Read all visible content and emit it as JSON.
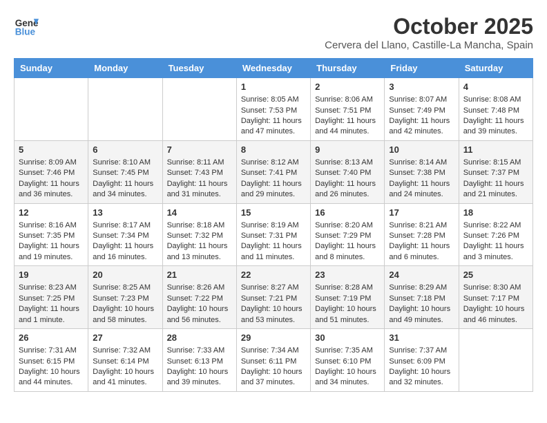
{
  "header": {
    "logo_line1": "General",
    "logo_line2": "Blue",
    "month_title": "October 2025",
    "subtitle": "Cervera del Llano, Castille-La Mancha, Spain"
  },
  "days_of_week": [
    "Sunday",
    "Monday",
    "Tuesday",
    "Wednesday",
    "Thursday",
    "Friday",
    "Saturday"
  ],
  "weeks": [
    [
      {
        "day": "",
        "content": ""
      },
      {
        "day": "",
        "content": ""
      },
      {
        "day": "",
        "content": ""
      },
      {
        "day": "1",
        "content": "Sunrise: 8:05 AM\nSunset: 7:53 PM\nDaylight: 11 hours and 47 minutes."
      },
      {
        "day": "2",
        "content": "Sunrise: 8:06 AM\nSunset: 7:51 PM\nDaylight: 11 hours and 44 minutes."
      },
      {
        "day": "3",
        "content": "Sunrise: 8:07 AM\nSunset: 7:49 PM\nDaylight: 11 hours and 42 minutes."
      },
      {
        "day": "4",
        "content": "Sunrise: 8:08 AM\nSunset: 7:48 PM\nDaylight: 11 hours and 39 minutes."
      }
    ],
    [
      {
        "day": "5",
        "content": "Sunrise: 8:09 AM\nSunset: 7:46 PM\nDaylight: 11 hours and 36 minutes."
      },
      {
        "day": "6",
        "content": "Sunrise: 8:10 AM\nSunset: 7:45 PM\nDaylight: 11 hours and 34 minutes."
      },
      {
        "day": "7",
        "content": "Sunrise: 8:11 AM\nSunset: 7:43 PM\nDaylight: 11 hours and 31 minutes."
      },
      {
        "day": "8",
        "content": "Sunrise: 8:12 AM\nSunset: 7:41 PM\nDaylight: 11 hours and 29 minutes."
      },
      {
        "day": "9",
        "content": "Sunrise: 8:13 AM\nSunset: 7:40 PM\nDaylight: 11 hours and 26 minutes."
      },
      {
        "day": "10",
        "content": "Sunrise: 8:14 AM\nSunset: 7:38 PM\nDaylight: 11 hours and 24 minutes."
      },
      {
        "day": "11",
        "content": "Sunrise: 8:15 AM\nSunset: 7:37 PM\nDaylight: 11 hours and 21 minutes."
      }
    ],
    [
      {
        "day": "12",
        "content": "Sunrise: 8:16 AM\nSunset: 7:35 PM\nDaylight: 11 hours and 19 minutes."
      },
      {
        "day": "13",
        "content": "Sunrise: 8:17 AM\nSunset: 7:34 PM\nDaylight: 11 hours and 16 minutes."
      },
      {
        "day": "14",
        "content": "Sunrise: 8:18 AM\nSunset: 7:32 PM\nDaylight: 11 hours and 13 minutes."
      },
      {
        "day": "15",
        "content": "Sunrise: 8:19 AM\nSunset: 7:31 PM\nDaylight: 11 hours and 11 minutes."
      },
      {
        "day": "16",
        "content": "Sunrise: 8:20 AM\nSunset: 7:29 PM\nDaylight: 11 hours and 8 minutes."
      },
      {
        "day": "17",
        "content": "Sunrise: 8:21 AM\nSunset: 7:28 PM\nDaylight: 11 hours and 6 minutes."
      },
      {
        "day": "18",
        "content": "Sunrise: 8:22 AM\nSunset: 7:26 PM\nDaylight: 11 hours and 3 minutes."
      }
    ],
    [
      {
        "day": "19",
        "content": "Sunrise: 8:23 AM\nSunset: 7:25 PM\nDaylight: 11 hours and 1 minute."
      },
      {
        "day": "20",
        "content": "Sunrise: 8:25 AM\nSunset: 7:23 PM\nDaylight: 10 hours and 58 minutes."
      },
      {
        "day": "21",
        "content": "Sunrise: 8:26 AM\nSunset: 7:22 PM\nDaylight: 10 hours and 56 minutes."
      },
      {
        "day": "22",
        "content": "Sunrise: 8:27 AM\nSunset: 7:21 PM\nDaylight: 10 hours and 53 minutes."
      },
      {
        "day": "23",
        "content": "Sunrise: 8:28 AM\nSunset: 7:19 PM\nDaylight: 10 hours and 51 minutes."
      },
      {
        "day": "24",
        "content": "Sunrise: 8:29 AM\nSunset: 7:18 PM\nDaylight: 10 hours and 49 minutes."
      },
      {
        "day": "25",
        "content": "Sunrise: 8:30 AM\nSunset: 7:17 PM\nDaylight: 10 hours and 46 minutes."
      }
    ],
    [
      {
        "day": "26",
        "content": "Sunrise: 7:31 AM\nSunset: 6:15 PM\nDaylight: 10 hours and 44 minutes."
      },
      {
        "day": "27",
        "content": "Sunrise: 7:32 AM\nSunset: 6:14 PM\nDaylight: 10 hours and 41 minutes."
      },
      {
        "day": "28",
        "content": "Sunrise: 7:33 AM\nSunset: 6:13 PM\nDaylight: 10 hours and 39 minutes."
      },
      {
        "day": "29",
        "content": "Sunrise: 7:34 AM\nSunset: 6:11 PM\nDaylight: 10 hours and 37 minutes."
      },
      {
        "day": "30",
        "content": "Sunrise: 7:35 AM\nSunset: 6:10 PM\nDaylight: 10 hours and 34 minutes."
      },
      {
        "day": "31",
        "content": "Sunrise: 7:37 AM\nSunset: 6:09 PM\nDaylight: 10 hours and 32 minutes."
      },
      {
        "day": "",
        "content": ""
      }
    ]
  ]
}
